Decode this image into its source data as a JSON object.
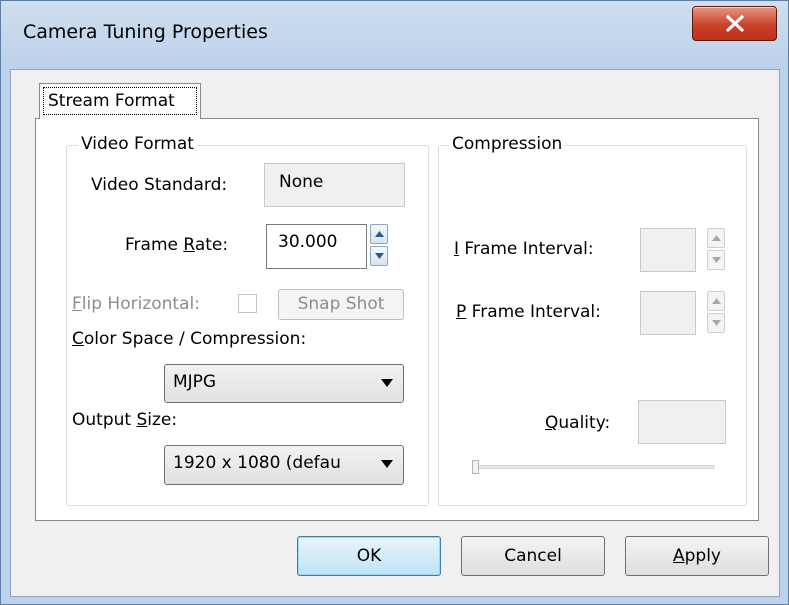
{
  "window": {
    "title": "Camera Tuning Properties"
  },
  "tabs": [
    {
      "label": "Stream Format"
    }
  ],
  "video_format": {
    "group_title": "Video Format",
    "video_standard_label": "Video Standard:",
    "video_standard_value": "None",
    "frame_rate_label_pre": "Frame ",
    "frame_rate_label_ul": "R",
    "frame_rate_label_post": "ate:",
    "frame_rate_value": "30.000",
    "flip_label_ul": "F",
    "flip_label_post": "lip Horizontal:",
    "flip_checked": false,
    "snapshot_label": "Snap Shot",
    "color_space_label_ul": "C",
    "color_space_label_post": "olor Space / Compression:",
    "color_space_value": "MJPG",
    "output_size_label_pre": "Output ",
    "output_size_label_ul": "S",
    "output_size_label_post": "ize:",
    "output_size_value": "1920 x 1080  (defau"
  },
  "compression": {
    "group_title": "Compression",
    "i_frame_label_ul": "I",
    "i_frame_label_post": " Frame Interval:",
    "i_frame_value": "",
    "p_frame_label_ul": "P",
    "p_frame_label_post": " Frame Interval:",
    "p_frame_value": "",
    "quality_label_ul": "Q",
    "quality_label_post": "uality:",
    "quality_value": "",
    "quality_slider_fraction": 0
  },
  "buttons": {
    "ok": "OK",
    "cancel": "Cancel",
    "apply_ul": "A",
    "apply_post": "pply"
  },
  "icons": {
    "close": "close-icon",
    "spin_up": "arrow-up-icon",
    "spin_down": "arrow-down-icon",
    "dropdown": "chevron-down-icon"
  },
  "colors": {
    "title_bar": "#bcd1ea",
    "close_button": "#c8432a",
    "default_button": "#bfe3f6",
    "disabled_text": "#8d8d8d"
  }
}
